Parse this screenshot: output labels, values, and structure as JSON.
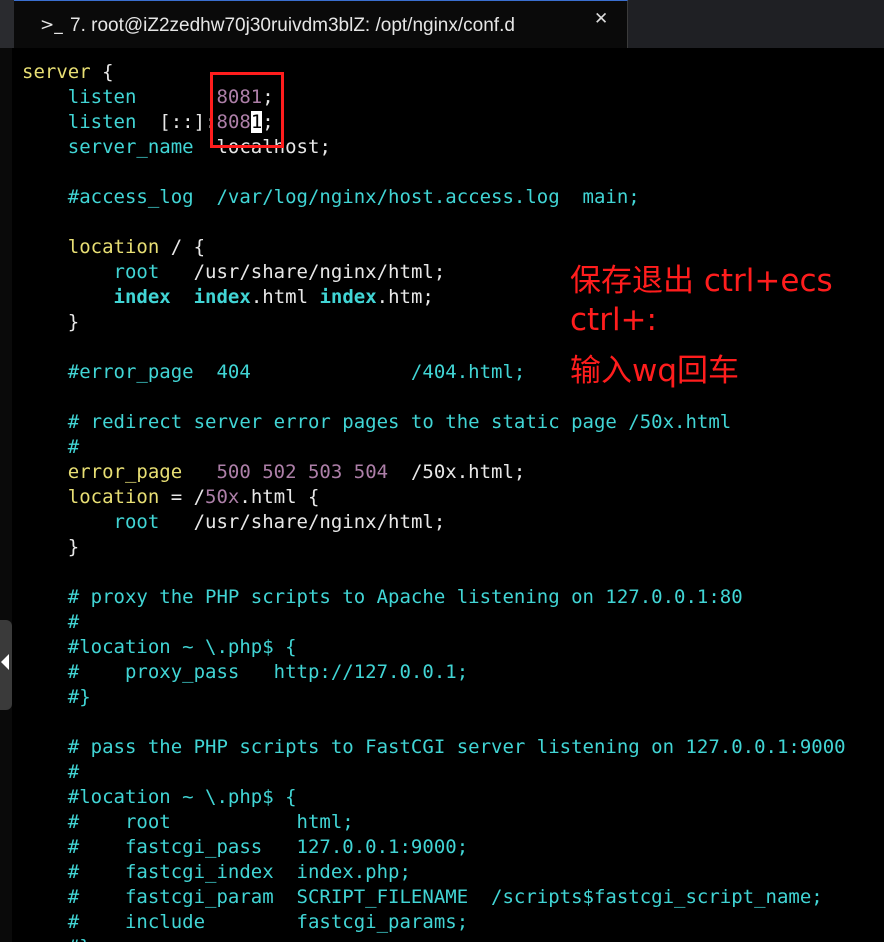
{
  "window": {
    "tab_icon": "terminal-prompt-icon",
    "tab_title": "7. root@iZ2zedhw70j30ruivdm3blZ: /opt/nginx/conf.d",
    "close_glyph": "✕"
  },
  "annotation": {
    "line1": "保存退出 ctrl+ecs",
    "line2": "ctrl+:",
    "line3": "输入wq回车",
    "color": "#ff1d1d"
  },
  "colors": {
    "keyword_yellow": "#e8df74",
    "keyword_cyan": "#41d5d5",
    "number_purple": "#ad7fa8",
    "text": "#e8e8e8",
    "background": "#000000"
  },
  "code": {
    "l1_a": "server",
    "l1_b": " {",
    "l2_kw": "listen",
    "l2_sp": "       ",
    "l2_num": "8081",
    "l2_end": ";",
    "l3_kw": "listen",
    "l3_sp": "  ",
    "l3_addr": "[::]:",
    "l3_num": "808",
    "l3_cursor": "1",
    "l3_end": ";",
    "l4_kw": "server_name",
    "l4_val": "  localhost;",
    "l6": "#access_log  /var/log/nginx/host.access.log  main;",
    "l8_kw": "location",
    "l8_rest": " / {",
    "l9_kw": "root",
    "l9_val": "   /usr/share/nginx/html;",
    "l10_kw": "index",
    "l10_a": "  ",
    "l10_b": "index",
    "l10_c": ".html ",
    "l10_d": "index",
    "l10_e": ".htm;",
    "l11": "}",
    "l13_a": "#error_page  404              /404.html;",
    "l15": "# redirect server error pages to the static page /50x.html",
    "l16": "#",
    "l17_kw": "error_page",
    "l17_sp": "   ",
    "l17_num": "500 502 503 504",
    "l17_end": "  /50x.html;",
    "l18_kw": "location",
    "l18_a": " = /",
    "l18_num": "50x",
    "l18_b": ".html {",
    "l19_kw": "root",
    "l19_val": "   /usr/share/nginx/html;",
    "l20": "}",
    "l22": "# proxy the PHP scripts to Apache listening on 127.0.0.1:80",
    "l23": "#",
    "l24": "#location ~ \\.php$ {",
    "l25": "#    proxy_pass   http://127.0.0.1;",
    "l26": "#}",
    "l28": "# pass the PHP scripts to FastCGI server listening on 127.0.0.1:9000",
    "l29": "#",
    "l30": "#location ~ \\.php$ {",
    "l31": "#    root           html;",
    "l32": "#    fastcgi_pass   127.0.0.1:9000;",
    "l33": "#    fastcgi_index  index.php;",
    "l34": "#    fastcgi_param  SCRIPT_FILENAME  /scripts$fastcgi_script_name;",
    "l35": "#    include        fastcgi_params;",
    "l36": "#}"
  }
}
